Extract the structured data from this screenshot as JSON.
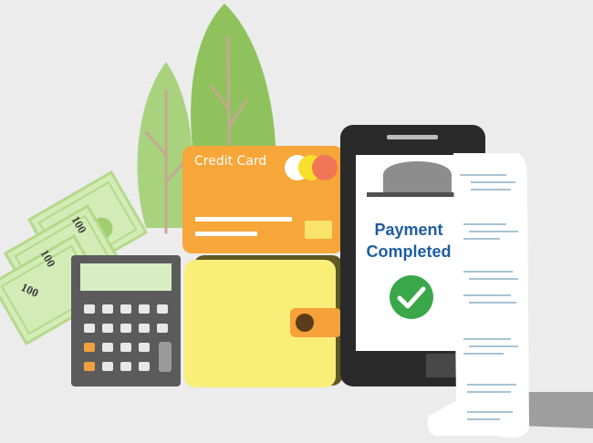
{
  "card": {
    "title": "Credit Card"
  },
  "phone": {
    "status_line1": "Payment",
    "status_line2": "Completed"
  },
  "banknotes": {
    "denomination": "100"
  },
  "colors": {
    "background": "#ececec",
    "tree": "#8fc25d",
    "card": "#f7a63a",
    "wallet": "#f9ef78",
    "phone": "#2a2a2a",
    "payment_text": "#1f5da0",
    "check": "#3aa84a",
    "calculator": "#5b5b5b",
    "banknote": "#d3ecb7"
  },
  "icons": [
    "check-icon",
    "card-chip-icon",
    "card-logo-icon",
    "wallet-clasp-icon",
    "hat-icon"
  ]
}
